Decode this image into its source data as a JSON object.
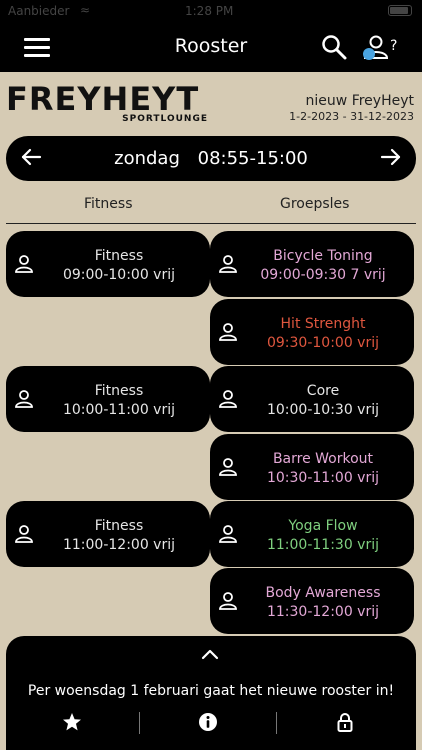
{
  "status_bar": {
    "carrier": "Aanbieder",
    "time": "1:28 PM"
  },
  "nav": {
    "title": "Rooster",
    "help_mark": "?"
  },
  "brand": {
    "logo": "FREYHEYT",
    "sub": "SPORTLOUNGE"
  },
  "schedule": {
    "name": "nieuw FreyHeyt",
    "range": "1-2-2023 - 31-12-2023"
  },
  "day": {
    "name": "zondag",
    "hours": "08:55-15:00"
  },
  "columns": {
    "left": "Fitness",
    "right": "Groepsles"
  },
  "classes_left": [
    {
      "name": "Fitness",
      "time": "09:00-10:00 vrij",
      "name_color": "#e6e6e6",
      "time_color": "#e6e6e6"
    },
    {
      "name": "Fitness",
      "time": "10:00-11:00 vrij",
      "name_color": "#e6e6e6",
      "time_color": "#e6e6e6"
    },
    {
      "name": "Fitness",
      "time": "11:00-12:00 vrij",
      "name_color": "#e6e6e6",
      "time_color": "#e6e6e6"
    }
  ],
  "classes_right": [
    {
      "name": "Bicycle Toning",
      "time": "09:00-09:30 7 vrij",
      "name_color": "#e3a8d6",
      "time_color": "#e3a8d6"
    },
    {
      "name": "Hit Strenght",
      "time": "09:30-10:00 vrij",
      "name_color": "#e0573f",
      "time_color": "#e0573f"
    },
    {
      "name": "Core",
      "time": "10:00-10:30 vrij",
      "name_color": "#e6e6e6",
      "time_color": "#e6e6e6"
    },
    {
      "name": "Barre Workout",
      "time": "10:30-11:00 vrij",
      "name_color": "#e3a8d6",
      "time_color": "#e3a8d6"
    },
    {
      "name": "Yoga Flow",
      "time": "11:00-11:30 vrij",
      "name_color": "#7fcf7f",
      "time_color": "#7fcf7f"
    },
    {
      "name": "Body Awareness",
      "time": "11:30-12:00 vrij",
      "name_color": "#e3a8d6",
      "time_color": "#e3a8d6"
    }
  ],
  "bottom": {
    "notice": "Per woensdag 1 februari gaat het nieuwe rooster in!"
  },
  "colors": {
    "bar_bg": "#000000",
    "page_bg": "#d6cbb4"
  }
}
